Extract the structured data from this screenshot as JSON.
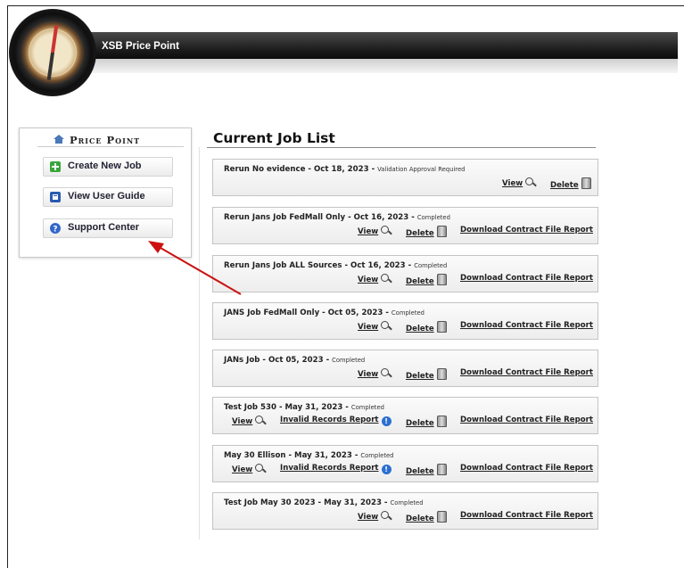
{
  "app": {
    "title": "XSB Price Point"
  },
  "sidebar": {
    "title": "Price Point",
    "items": [
      {
        "label": "Create New Job",
        "icon": "plus-icon",
        "color": "#3aa53a"
      },
      {
        "label": "View User Guide",
        "icon": "book-icon",
        "color": "#2a5ab0"
      },
      {
        "label": "Support Center",
        "icon": "help-icon",
        "color": "#3366cc"
      }
    ]
  },
  "main": {
    "title": "Current Job List",
    "jobs": [
      {
        "name": "Rerun No evidence - Oct 18, 2023",
        "status": "Validation Approval Required",
        "view": "View",
        "delete": "Delete"
      },
      {
        "name": "Rerun Jans Job FedMall Only - Oct 16, 2023",
        "status": "Completed",
        "view": "View",
        "delete": "Delete",
        "download": "Download Contract File Report"
      },
      {
        "name": "Rerun Jans Job ALL Sources - Oct 16, 2023",
        "status": "Completed",
        "view": "View",
        "delete": "Delete",
        "download": "Download Contract File Report"
      },
      {
        "name": "JANS Job FedMall Only - Oct 05, 2023",
        "status": "Completed",
        "view": "View",
        "delete": "Delete",
        "download": "Download Contract File Report"
      },
      {
        "name": "JANs Job - Oct 05, 2023",
        "status": "Completed",
        "view": "View",
        "delete": "Delete",
        "download": "Download Contract File Report"
      },
      {
        "name": "Test Job 530 - May 31, 2023",
        "status": "Completed",
        "view": "View",
        "invalid": "Invalid Records Report",
        "delete": "Delete",
        "download": "Download Contract File Report"
      },
      {
        "name": "May 30 Ellison - May 31, 2023",
        "status": "Completed",
        "view": "View",
        "invalid": "Invalid Records Report",
        "delete": "Delete",
        "download": "Download Contract File Report"
      },
      {
        "name": "Test Job May 30 2023 - May 31, 2023",
        "status": "Completed",
        "view": "View",
        "delete": "Delete",
        "download": "Download Contract File Report"
      }
    ]
  },
  "colors": {
    "header": "#1a1a1a",
    "annotation_arrow": "#cc1111"
  }
}
